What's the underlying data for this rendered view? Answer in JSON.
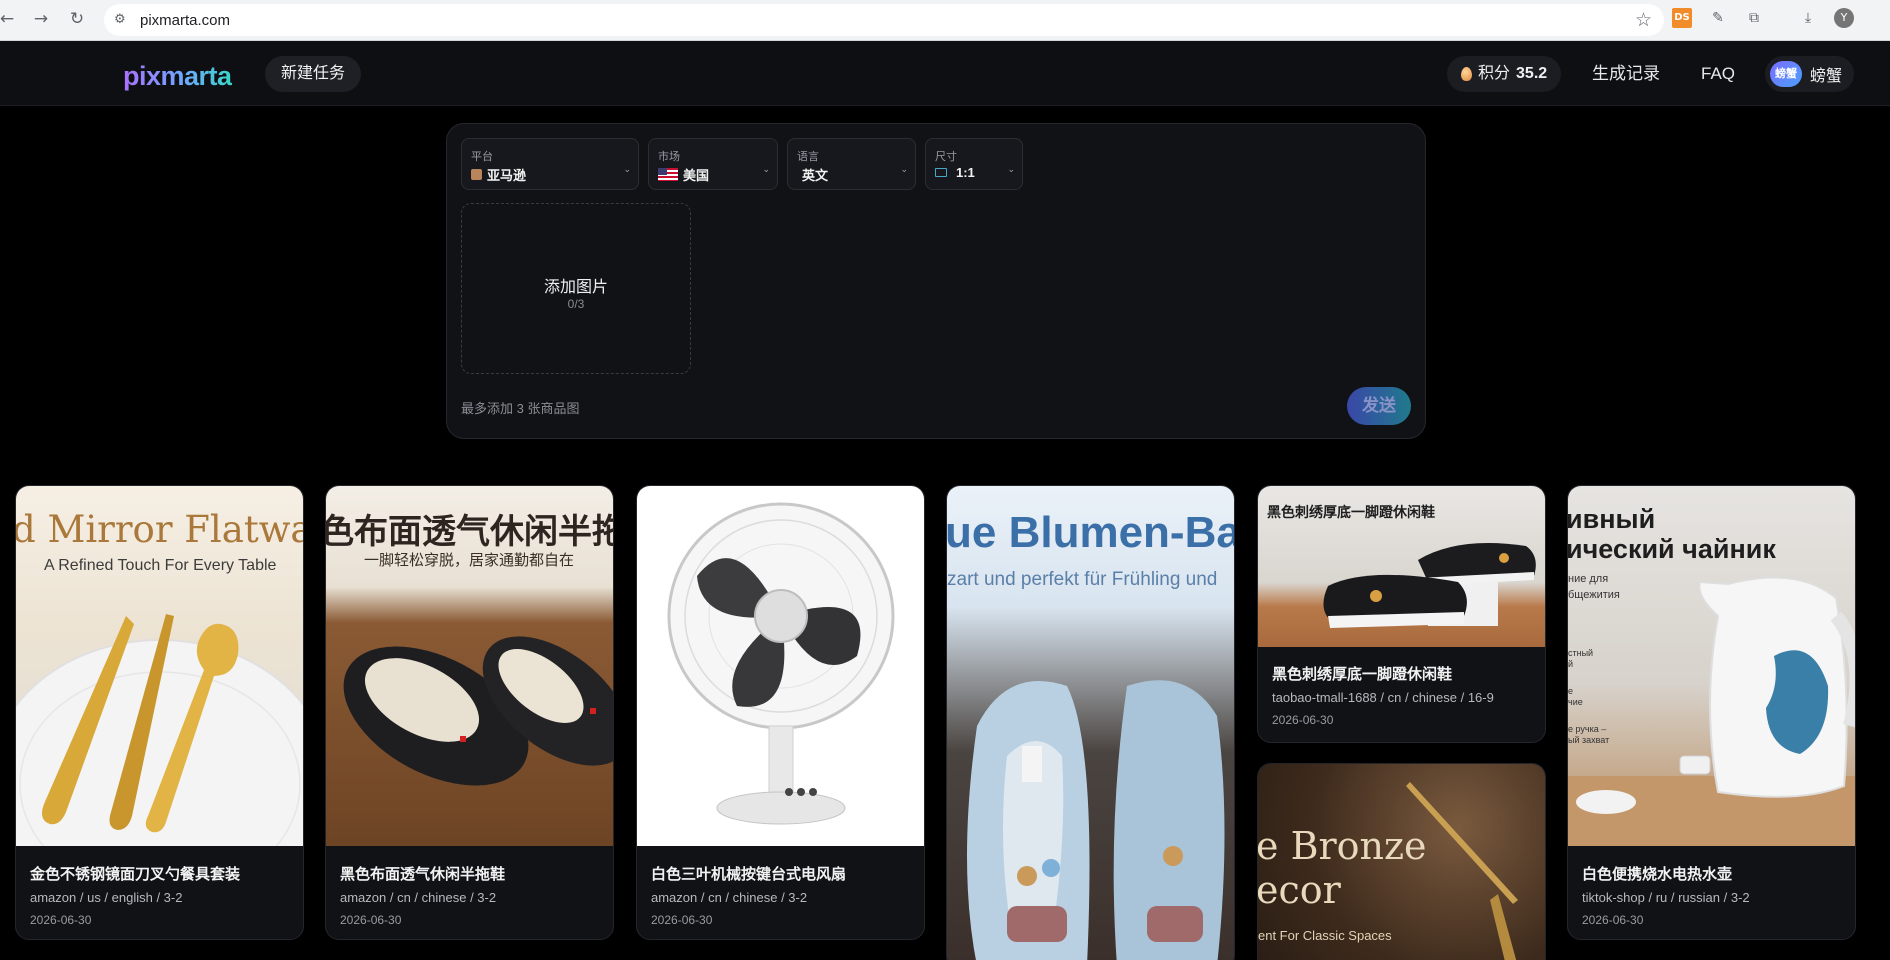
{
  "browser": {
    "url": "pixmarta.com",
    "profile_initial": "Y",
    "ext_ds_label": "DS"
  },
  "header": {
    "logo": "pixmarta",
    "new_task_label": "新建任务",
    "points_label": "积分",
    "points_value": "35.2",
    "history_label": "生成记录",
    "faq_label": "FAQ",
    "user_avatar_text": "螃蟹",
    "user_name": "螃蟹"
  },
  "composer": {
    "platform": {
      "label": "平台",
      "value": "亚马逊"
    },
    "market": {
      "label": "市场",
      "value": "美国"
    },
    "language": {
      "label": "语言",
      "value": "英文"
    },
    "size": {
      "label": "尺寸",
      "value": "1:1"
    },
    "upload_title": "添加图片",
    "upload_count": "0/3",
    "hint": "最多添加 3 张商品图",
    "send_label": "发送"
  },
  "cards": [
    {
      "title": "金色不锈钢镜面刀叉勺餐具套装",
      "meta": "amazon / us / english / 3-2",
      "date": "2026-06-30",
      "img_head": "d Mirror Flatware",
      "img_sub": "A Refined Touch For Every Table"
    },
    {
      "title": "黑色布面透气休闲半拖鞋",
      "meta": "amazon / cn / chinese / 3-2",
      "date": "2026-06-30",
      "img_head": "色布面透气休闲半拖",
      "img_sub": "一脚轻松穿脱，居家通勤都自在"
    },
    {
      "title": "白色三叶机械按键台式电风扇",
      "meta": "amazon / cn / chinese / 3-2",
      "date": "2026-06-30"
    },
    {
      "img_head": "ue Blumen-Ba",
      "img_sub": "zart und perfekt für Frühling und"
    },
    {
      "title": "黑色刺绣厚底一脚蹬休闲鞋",
      "meta": "taobao-tmall-1688 / cn / chinese / 16-9",
      "date": "2026-06-30",
      "img_head": "黑色刺绣厚底一脚蹬休闲鞋"
    },
    {
      "title": "白色便携烧水电热水壶",
      "meta": "tiktok-shop / ru / russian / 3-2",
      "date": "2026-06-30",
      "img_head_1": "ивный",
      "img_head_2": "ический чайник",
      "img_sub_1": "ние для",
      "img_sub_2": "бщежития",
      "img_note_1": "стный",
      "img_note_2": "й",
      "img_note_3": "е",
      "img_note_4": "чие",
      "img_note_5": "е ручка –",
      "img_note_6": "ый захват"
    },
    {
      "img_head_1": "e Bronze",
      "img_head_2": "ecor",
      "img_sub": "ent For Classic Spaces"
    }
  ]
}
